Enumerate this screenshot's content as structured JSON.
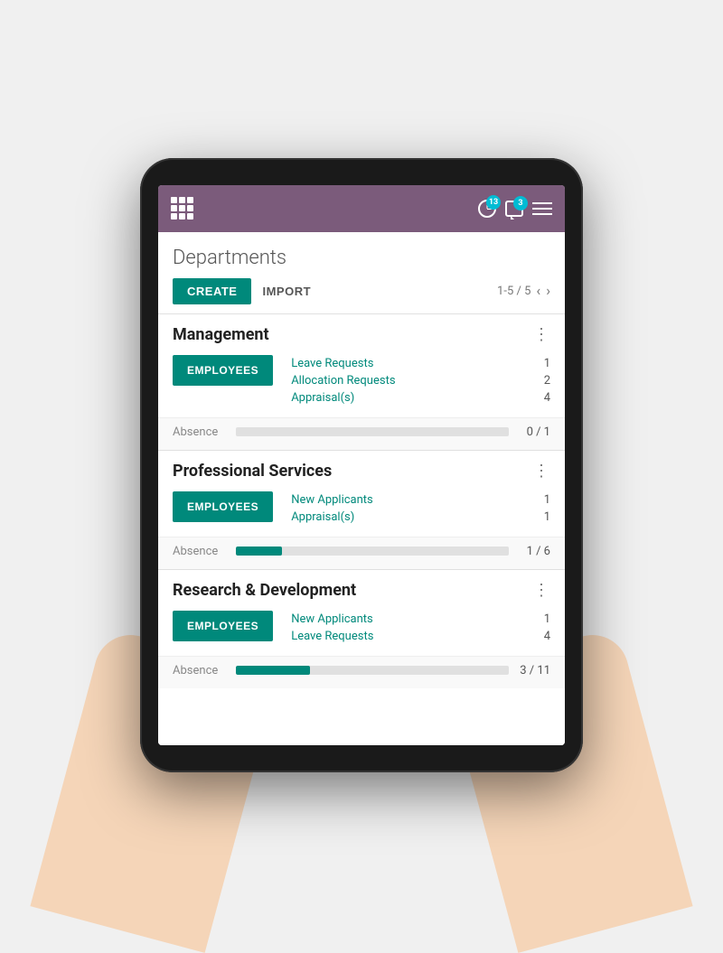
{
  "navbar": {
    "badge_activity": "13",
    "badge_messages": "3",
    "grid_icon_label": "grid-menu",
    "hamburger_label": "hamburger-menu"
  },
  "page": {
    "title": "Departments",
    "toolbar": {
      "create_label": "CREATE",
      "import_label": "IMPORT",
      "pagination": "1-5 / 5"
    }
  },
  "departments": [
    {
      "name": "Management",
      "employees_label": "EMPLOYEES",
      "stats": [
        {
          "label": "Leave Requests",
          "value": "1"
        },
        {
          "label": "Allocation Requests",
          "value": "2"
        },
        {
          "label": "Appraisal(s)",
          "value": "4"
        }
      ],
      "absence_label": "Absence",
      "absence_current": 0,
      "absence_total": 1,
      "absence_display": "0 / 1",
      "absence_percent": 0
    },
    {
      "name": "Professional Services",
      "employees_label": "EMPLOYEES",
      "stats": [
        {
          "label": "New Applicants",
          "value": "1"
        },
        {
          "label": "Appraisal(s)",
          "value": "1"
        }
      ],
      "absence_label": "Absence",
      "absence_current": 1,
      "absence_total": 6,
      "absence_display": "1 / 6",
      "absence_percent": 17
    },
    {
      "name": "Research & Development",
      "employees_label": "EMPLOYEES",
      "stats": [
        {
          "label": "New Applicants",
          "value": "1"
        },
        {
          "label": "Leave Requests",
          "value": "4"
        }
      ],
      "absence_label": "Absence",
      "absence_current": 3,
      "absence_total": 11,
      "absence_display": "3 / 11",
      "absence_percent": 27
    }
  ],
  "colors": {
    "navbar_bg": "#7b5b7b",
    "teal": "#00897b",
    "badge_teal": "#00bcd4"
  }
}
